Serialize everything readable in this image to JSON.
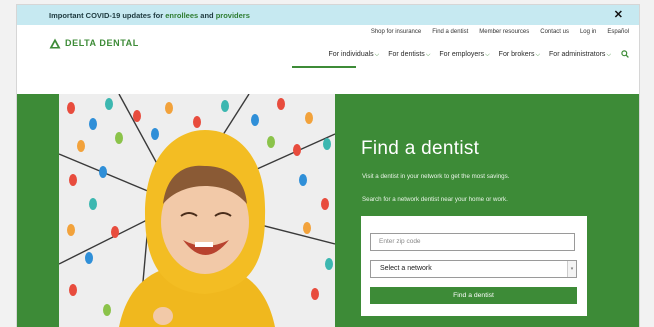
{
  "alert": {
    "prefix": "Important COVID-19 updates for ",
    "link1": "enrollees",
    "middle": " and ",
    "link2": "providers",
    "close": "✕"
  },
  "logo": {
    "text": "DELTA DENTAL",
    "mark": "®"
  },
  "utility_nav": [
    "Shop for insurance",
    "Find a dentist",
    "Member resources",
    "Contact us",
    "Log in",
    "Español"
  ],
  "main_nav": {
    "items": [
      "For individuals",
      "For dentists",
      "For employers",
      "For brokers",
      "For administrators"
    ],
    "chevron": "⌵",
    "search_icon": "search-icon",
    "active": "For individuals"
  },
  "hero": {
    "title": "Find a dentist",
    "sub1": "Visit a dentist in your network to get the most savings.",
    "sub2": "Search for a network dentist near your home or work."
  },
  "form": {
    "zip_placeholder": "Enter zip code",
    "select_value": "Select a network",
    "button": "Find a dentist"
  },
  "colors": {
    "brand_green": "#3d8b37",
    "alert_bg": "#c6e9f1"
  }
}
